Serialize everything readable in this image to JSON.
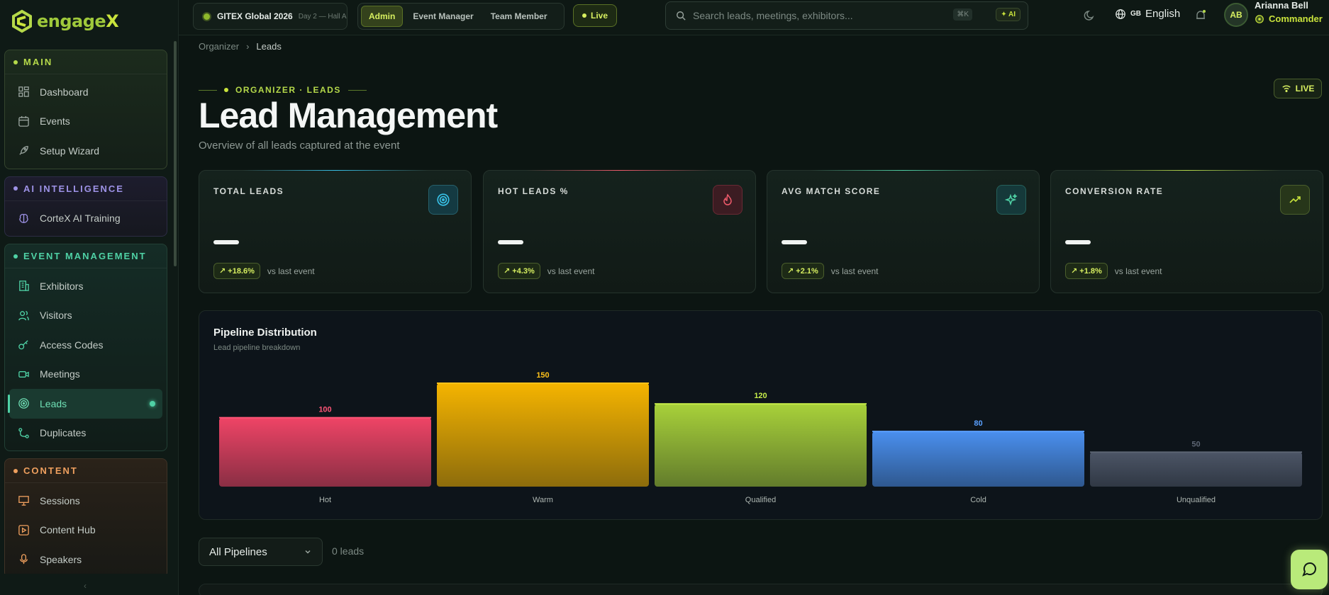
{
  "brand": {
    "name_a": "engage",
    "name_b": "X"
  },
  "topbar": {
    "event_name": "GITEX Global 2026",
    "event_sub": "Day 2 — Hall A",
    "roles": [
      "Admin",
      "Event Manager",
      "Team Member"
    ],
    "active_role": "Admin",
    "live": "Live",
    "search_placeholder": "Search leads, meetings, exhibitors...",
    "search_kbd": "⌘K",
    "ai_label": "AI",
    "lang_code": "GB",
    "lang_name": "English",
    "avatar_initials": "AB",
    "user_name": "Arianna Bell",
    "user_role": "Commander"
  },
  "sidebar": {
    "groups": [
      {
        "title": "MAIN",
        "items": [
          "Dashboard",
          "Events",
          "Setup Wizard"
        ]
      },
      {
        "title": "AI INTELLIGENCE",
        "items": [
          "CorteX AI Training"
        ]
      },
      {
        "title": "EVENT MANAGEMENT",
        "items": [
          "Exhibitors",
          "Visitors",
          "Access Codes",
          "Meetings",
          "Leads",
          "Duplicates"
        ]
      },
      {
        "title": "CONTENT",
        "items": [
          "Sessions",
          "Content Hub",
          "Speakers"
        ]
      }
    ],
    "active_item": "Leads"
  },
  "breadcrumb": {
    "root": "Organizer",
    "sep": "›",
    "current": "Leads"
  },
  "header": {
    "eyebrow": "ORGANIZER · LEADS",
    "title": "Lead Management",
    "subtitle": "Overview of all leads captured at the event",
    "live_badge": "LIVE"
  },
  "stats": [
    {
      "title": "TOTAL LEADS",
      "change": "+18.6%",
      "suffix": "vs last event",
      "icon": "target-icon",
      "accent": "#38c0e6"
    },
    {
      "title": "HOT LEADS %",
      "change": "+4.3%",
      "suffix": "vs last event",
      "icon": "flame-icon",
      "accent": "#ef5b6b"
    },
    {
      "title": "AVG MATCH SCORE",
      "change": "+2.1%",
      "suffix": "vs last event",
      "icon": "sparkles-icon",
      "accent": "#4fd1a5"
    },
    {
      "title": "CONVERSION RATE",
      "change": "+1.8%",
      "suffix": "vs last event",
      "icon": "trend-up-icon",
      "accent": "#b5d94a"
    }
  ],
  "pipeline": {
    "title": "Pipeline Distribution",
    "subtitle": "Lead pipeline breakdown"
  },
  "chart_data": {
    "type": "bar",
    "categories": [
      "Hot",
      "Warm",
      "Qualified",
      "Cold",
      "Unqualified"
    ],
    "values": [
      100,
      150,
      120,
      80,
      50
    ],
    "colors": [
      "#ef4466",
      "#f5b400",
      "#a8d13a",
      "#4a8fee",
      "#4c5566"
    ],
    "label_colors": [
      "#ff5577",
      "#ffc21a",
      "#c7ee4a",
      "#5aa0ff",
      "#5d6674"
    ],
    "ylim": [
      0,
      150
    ]
  },
  "filter": {
    "selected": "All Pipelines",
    "count": "0 leads"
  }
}
